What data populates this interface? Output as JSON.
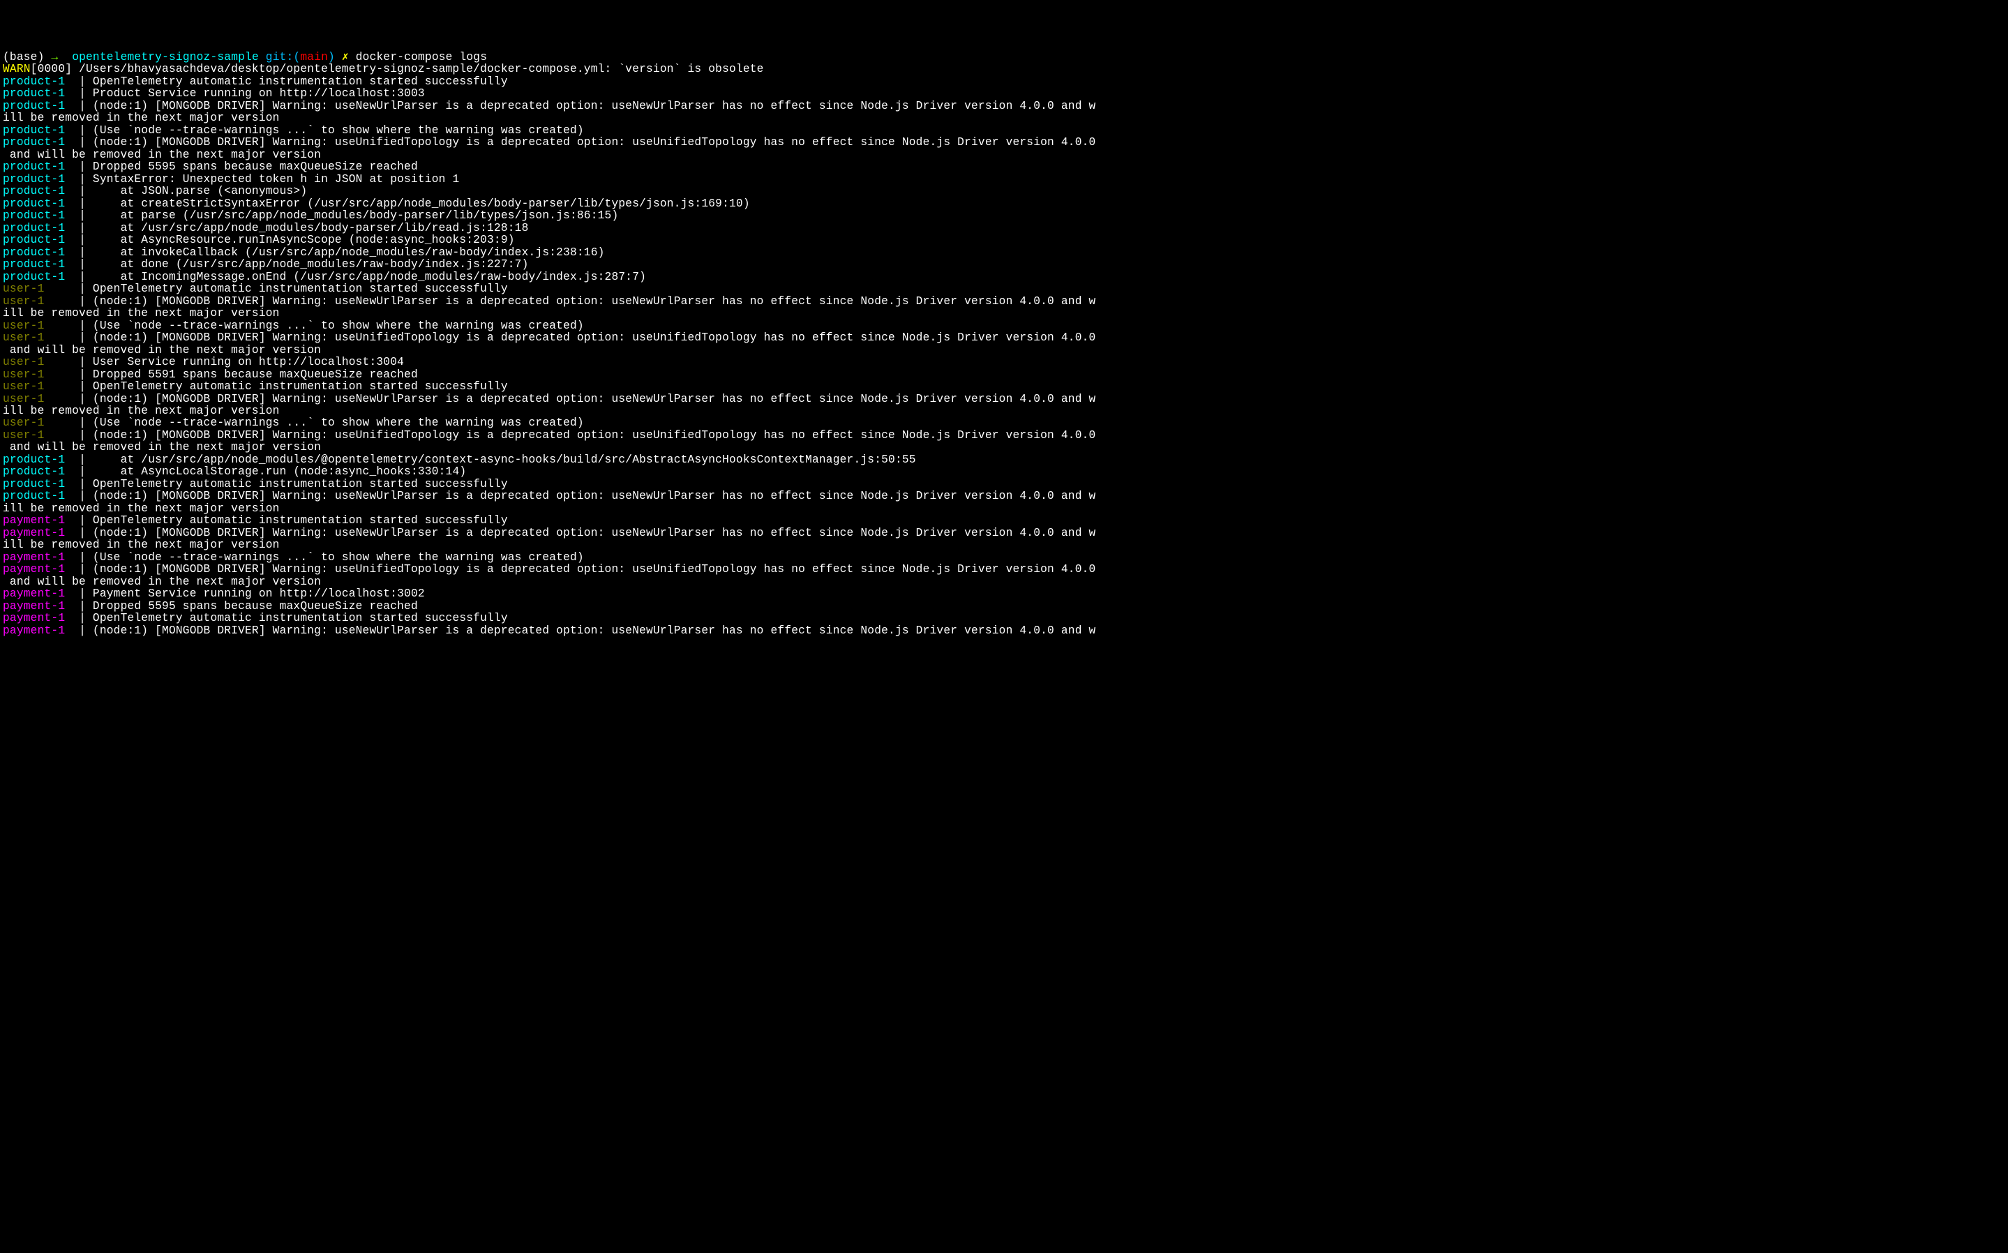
{
  "prompt": {
    "base": "(base)",
    "arrow": "→",
    "path": "opentelemetry-signoz-sample",
    "git_label": "git:(",
    "branch": "main",
    "git_close": ")",
    "dirty": "✗",
    "command": "docker-compose logs"
  },
  "lines": [
    {
      "type": "warn",
      "prefix": "WARN",
      "msg": "[0000] /Users/bhavyasachdeva/desktop/opentelemetry-signoz-sample/docker-compose.yml: `version` is obsolete"
    },
    {
      "type": "svc",
      "svc": "product-1",
      "msg": "OpenTelemetry automatic instrumentation started successfully"
    },
    {
      "type": "svc",
      "svc": "product-1",
      "msg": "Product Service running on http://localhost:3003"
    },
    {
      "type": "svc",
      "svc": "product-1",
      "msg": "(node:1) [MONGODB DRIVER] Warning: useNewUrlParser is a deprecated option: useNewUrlParser has no effect since Node.js Driver version 4.0.0 and w"
    },
    {
      "type": "plain",
      "msg": "ill be removed in the next major version"
    },
    {
      "type": "svc",
      "svc": "product-1",
      "msg": "(Use `node --trace-warnings ...` to show where the warning was created)"
    },
    {
      "type": "svc",
      "svc": "product-1",
      "msg": "(node:1) [MONGODB DRIVER] Warning: useUnifiedTopology is a deprecated option: useUnifiedTopology has no effect since Node.js Driver version 4.0.0"
    },
    {
      "type": "plain",
      "msg": " and will be removed in the next major version"
    },
    {
      "type": "svc",
      "svc": "product-1",
      "msg": "Dropped 5595 spans because maxQueueSize reached"
    },
    {
      "type": "svc",
      "svc": "product-1",
      "msg": "SyntaxError: Unexpected token h in JSON at position 1"
    },
    {
      "type": "svc",
      "svc": "product-1",
      "msg": "    at JSON.parse (<anonymous>)"
    },
    {
      "type": "svc",
      "svc": "product-1",
      "msg": "    at createStrictSyntaxError (/usr/src/app/node_modules/body-parser/lib/types/json.js:169:10)"
    },
    {
      "type": "svc",
      "svc": "product-1",
      "msg": "    at parse (/usr/src/app/node_modules/body-parser/lib/types/json.js:86:15)"
    },
    {
      "type": "svc",
      "svc": "product-1",
      "msg": "    at /usr/src/app/node_modules/body-parser/lib/read.js:128:18"
    },
    {
      "type": "svc",
      "svc": "product-1",
      "msg": "    at AsyncResource.runInAsyncScope (node:async_hooks:203:9)"
    },
    {
      "type": "svc",
      "svc": "product-1",
      "msg": "    at invokeCallback (/usr/src/app/node_modules/raw-body/index.js:238:16)"
    },
    {
      "type": "svc",
      "svc": "product-1",
      "msg": "    at done (/usr/src/app/node_modules/raw-body/index.js:227:7)"
    },
    {
      "type": "svc",
      "svc": "product-1",
      "msg": "    at IncomingMessage.onEnd (/usr/src/app/node_modules/raw-body/index.js:287:7)"
    },
    {
      "type": "svc",
      "svc": "user-1",
      "msg": "OpenTelemetry automatic instrumentation started successfully"
    },
    {
      "type": "svc",
      "svc": "user-1",
      "msg": "(node:1) [MONGODB DRIVER] Warning: useNewUrlParser is a deprecated option: useNewUrlParser has no effect since Node.js Driver version 4.0.0 and w"
    },
    {
      "type": "plain",
      "msg": "ill be removed in the next major version"
    },
    {
      "type": "svc",
      "svc": "user-1",
      "msg": "(Use `node --trace-warnings ...` to show where the warning was created)"
    },
    {
      "type": "svc",
      "svc": "user-1",
      "msg": "(node:1) [MONGODB DRIVER] Warning: useUnifiedTopology is a deprecated option: useUnifiedTopology has no effect since Node.js Driver version 4.0.0"
    },
    {
      "type": "plain",
      "msg": " and will be removed in the next major version"
    },
    {
      "type": "svc",
      "svc": "user-1",
      "msg": "User Service running on http://localhost:3004"
    },
    {
      "type": "svc",
      "svc": "user-1",
      "msg": "Dropped 5591 spans because maxQueueSize reached"
    },
    {
      "type": "svc",
      "svc": "user-1",
      "msg": "OpenTelemetry automatic instrumentation started successfully"
    },
    {
      "type": "svc",
      "svc": "user-1",
      "msg": "(node:1) [MONGODB DRIVER] Warning: useNewUrlParser is a deprecated option: useNewUrlParser has no effect since Node.js Driver version 4.0.0 and w"
    },
    {
      "type": "plain",
      "msg": "ill be removed in the next major version"
    },
    {
      "type": "svc",
      "svc": "user-1",
      "msg": "(Use `node --trace-warnings ...` to show where the warning was created)"
    },
    {
      "type": "svc",
      "svc": "user-1",
      "msg": "(node:1) [MONGODB DRIVER] Warning: useUnifiedTopology is a deprecated option: useUnifiedTopology has no effect since Node.js Driver version 4.0.0"
    },
    {
      "type": "plain",
      "msg": " and will be removed in the next major version"
    },
    {
      "type": "svc",
      "svc": "product-1",
      "msg": "    at /usr/src/app/node_modules/@opentelemetry/context-async-hooks/build/src/AbstractAsyncHooksContextManager.js:50:55"
    },
    {
      "type": "svc",
      "svc": "product-1",
      "msg": "    at AsyncLocalStorage.run (node:async_hooks:330:14)"
    },
    {
      "type": "svc",
      "svc": "product-1",
      "msg": "OpenTelemetry automatic instrumentation started successfully"
    },
    {
      "type": "svc",
      "svc": "product-1",
      "msg": "(node:1) [MONGODB DRIVER] Warning: useNewUrlParser is a deprecated option: useNewUrlParser has no effect since Node.js Driver version 4.0.0 and w"
    },
    {
      "type": "plain",
      "msg": "ill be removed in the next major version"
    },
    {
      "type": "svc",
      "svc": "payment-1",
      "msg": "OpenTelemetry automatic instrumentation started successfully"
    },
    {
      "type": "svc",
      "svc": "payment-1",
      "msg": "(node:1) [MONGODB DRIVER] Warning: useNewUrlParser is a deprecated option: useNewUrlParser has no effect since Node.js Driver version 4.0.0 and w"
    },
    {
      "type": "plain",
      "msg": "ill be removed in the next major version"
    },
    {
      "type": "svc",
      "svc": "payment-1",
      "msg": "(Use `node --trace-warnings ...` to show where the warning was created)"
    },
    {
      "type": "svc",
      "svc": "payment-1",
      "msg": "(node:1) [MONGODB DRIVER] Warning: useUnifiedTopology is a deprecated option: useUnifiedTopology has no effect since Node.js Driver version 4.0.0"
    },
    {
      "type": "plain",
      "msg": " and will be removed in the next major version"
    },
    {
      "type": "svc",
      "svc": "payment-1",
      "msg": "Payment Service running on http://localhost:3002"
    },
    {
      "type": "svc",
      "svc": "payment-1",
      "msg": "Dropped 5595 spans because maxQueueSize reached"
    },
    {
      "type": "svc",
      "svc": "payment-1",
      "msg": "OpenTelemetry automatic instrumentation started successfully"
    },
    {
      "type": "svc",
      "svc": "payment-1",
      "msg": "(node:1) [MONGODB DRIVER] Warning: useNewUrlParser is a deprecated option: useNewUrlParser has no effect since Node.js Driver version 4.0.0 and w"
    }
  ],
  "service_colors": {
    "product-1": "svc-product",
    "user-1": "svc-user",
    "payment-1": "svc-payment"
  },
  "pipe": "  | "
}
